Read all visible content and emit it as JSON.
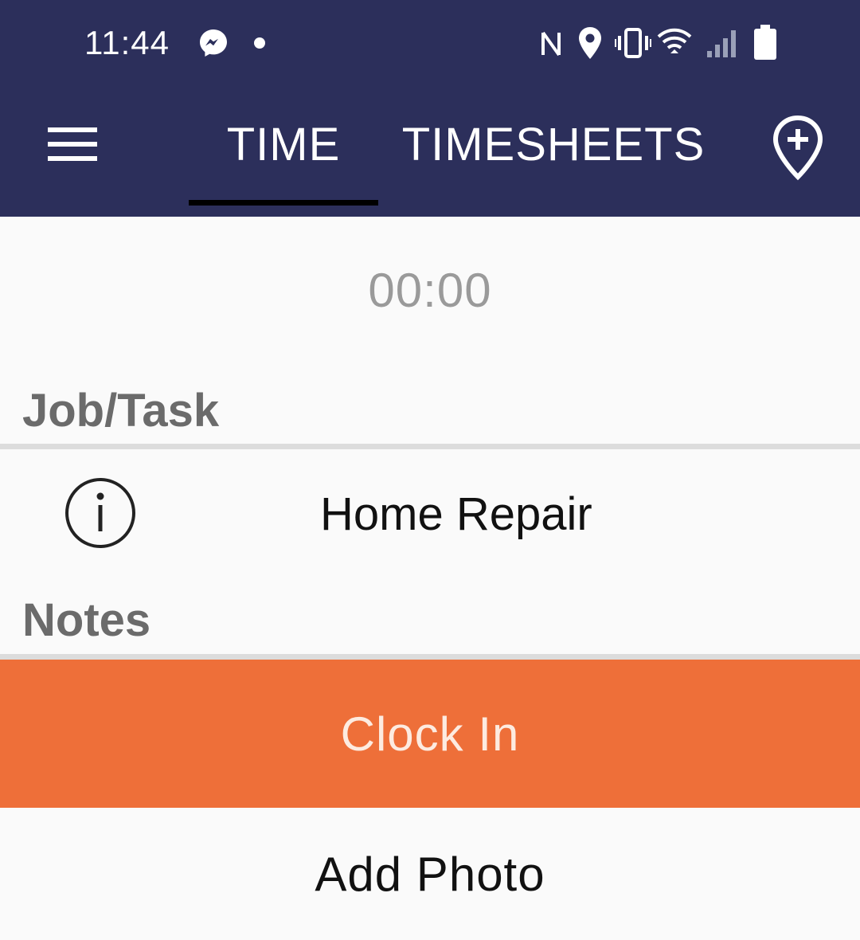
{
  "status_bar": {
    "time": "11:44",
    "icons": [
      "messenger-icon",
      "notification-dot-icon",
      "nfc-icon",
      "location-icon",
      "vibrate-icon",
      "wifi-icon",
      "cell-signal-icon",
      "battery-icon"
    ]
  },
  "app_bar": {
    "menu_icon": "hamburger-menu-icon",
    "tabs": [
      {
        "label": "TIME",
        "selected": true
      },
      {
        "label": "TIMESHEETS",
        "selected": false
      }
    ],
    "action_icon": "add-location-icon"
  },
  "timer": {
    "value": "00:00"
  },
  "job_task": {
    "label": "Job/Task",
    "info_icon": "info-icon",
    "value": "Home Repair"
  },
  "notes": {
    "label": "Notes"
  },
  "actions": {
    "clock_in_label": "Clock In",
    "add_photo_label": "Add Photo"
  },
  "colors": {
    "primary": "#2c2f5b",
    "accent": "#ee6f39",
    "tab_indicator": "#000000",
    "background": "#fafafa"
  }
}
